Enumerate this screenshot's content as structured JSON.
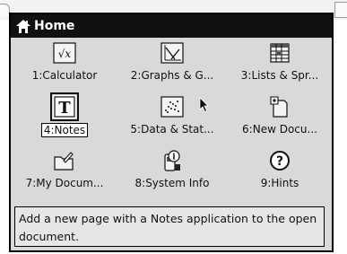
{
  "window": {
    "title": "Home"
  },
  "apps": [
    {
      "label": "1:Calculator",
      "icon": "calculator-sqrt-icon"
    },
    {
      "label": "2:Graphs & G...",
      "icon": "graph-icon"
    },
    {
      "label": "3:Lists & Spr...",
      "icon": "spreadsheet-icon"
    },
    {
      "label": "4:Notes",
      "icon": "notes-T-icon",
      "selected": true
    },
    {
      "label": "5:Data & Stat...",
      "icon": "scatter-plot-icon"
    },
    {
      "label": "6:New Docu...",
      "icon": "new-document-icon"
    },
    {
      "label": "7:My Docum...",
      "icon": "folder-icon"
    },
    {
      "label": "8:System Info",
      "icon": "system-info-icon"
    },
    {
      "label": "9:Hints",
      "icon": "question-icon"
    }
  ],
  "calculator_symbol": "√x",
  "notes_symbol": "T",
  "hints_symbol": "?",
  "help_text": "Add a new page with a Notes application to the open document.",
  "colors": {
    "title_bg": "#111111",
    "window_bg": "#d9d9d9",
    "help_bg": "#e6e6e6"
  }
}
